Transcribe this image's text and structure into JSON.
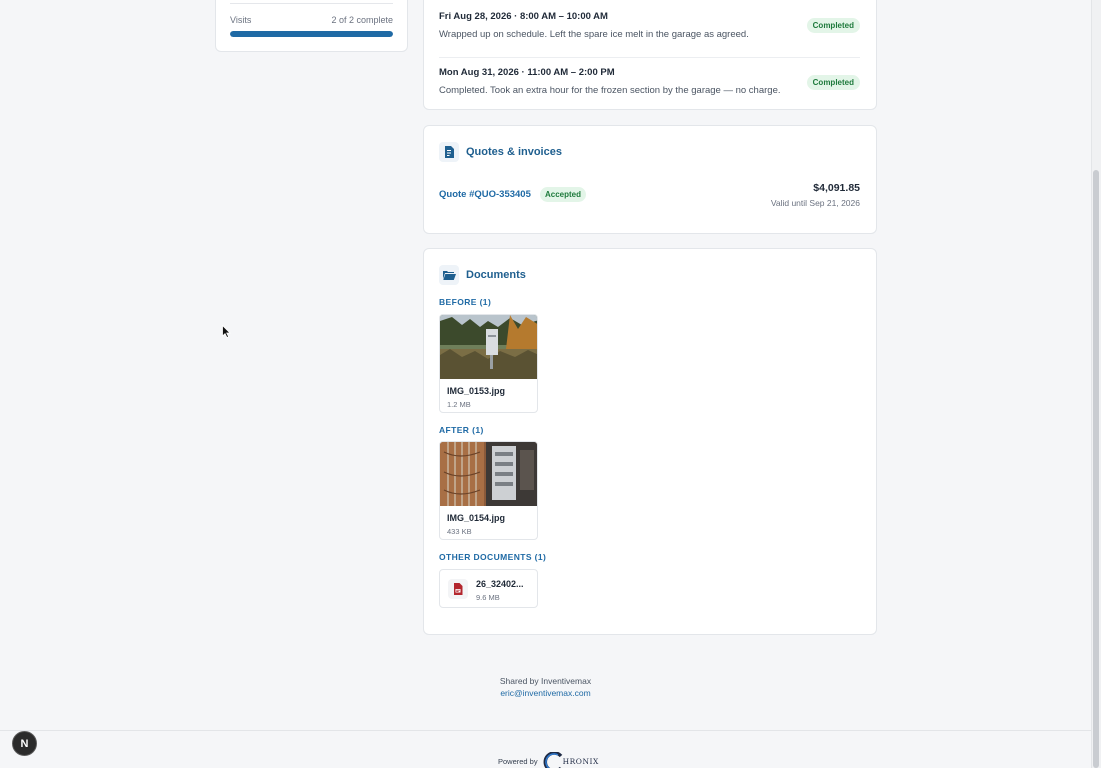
{
  "progress": {
    "label": "Visits",
    "count": "2 of 2 complete",
    "fraction": 1.0
  },
  "visits": [
    {
      "time": "Fri Aug 28, 2026 · 8:00 AM – 10:00 AM",
      "note": "Wrapped up on schedule. Left the spare ice melt in the garage as agreed.",
      "status": "Completed"
    },
    {
      "time": "Mon Aug 31, 2026 · 11:00 AM – 2:00 PM",
      "note": "Completed. Took an extra hour for the frozen section by the garage — no charge.",
      "status": "Completed"
    }
  ],
  "quotes": {
    "title": "Quotes & invoices",
    "icon": "invoice-icon",
    "items": [
      {
        "label": "Quote #QUO-353405",
        "status": "Accepted",
        "amount": "$4,091.85",
        "valid": "Valid until Sep 21, 2026"
      }
    ]
  },
  "documents": {
    "title": "Documents",
    "icon": "folder-open-icon",
    "groups": [
      {
        "label": "BEFORE (1)",
        "files": [
          {
            "name": "IMG_0153.jpg",
            "size": "1.2 MB"
          }
        ]
      },
      {
        "label": "AFTER (1)",
        "files": [
          {
            "name": "IMG_0154.jpg",
            "size": "433 KB"
          }
        ]
      },
      {
        "label": "OTHER DOCUMENTS (1)",
        "files": [
          {
            "name": "26_32402...",
            "size": "9.6 MB",
            "icon": "pdf-file-icon"
          }
        ]
      }
    ]
  },
  "footer": {
    "shared_by": "Shared by Inventivemax",
    "email": "eric@inventivemax.com",
    "powered_by": "Powered by",
    "logo_text": "HRONIX"
  },
  "launcher": {
    "label": "N"
  },
  "colors": {
    "accent": "#1f6aa5",
    "success_text": "#1e7a3c",
    "success_bg": "#e3f5e8",
    "background": "#f5f6f8"
  }
}
